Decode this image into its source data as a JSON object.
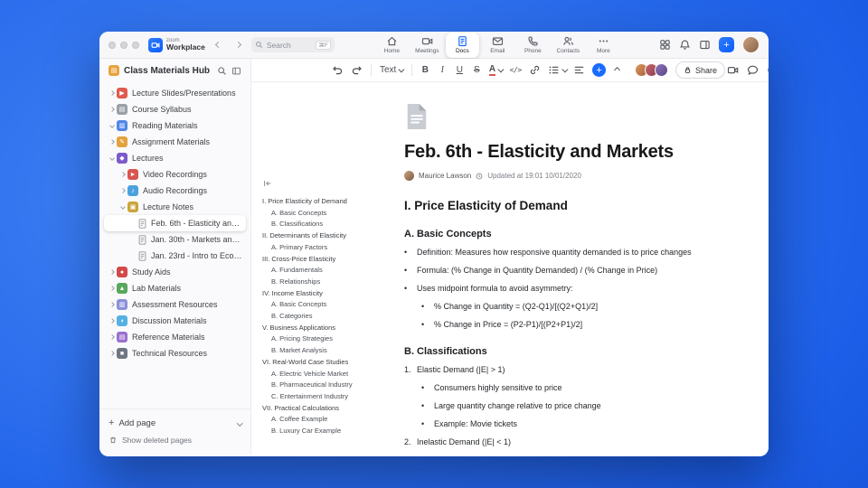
{
  "titlebar": {
    "brand_zoom": "zoom",
    "brand_workplace": "Workplace",
    "search": {
      "placeholder": "Search",
      "shortcut": "⌘F"
    },
    "tabs": [
      {
        "label": "Home"
      },
      {
        "label": "Meetings"
      },
      {
        "label": "Docs"
      },
      {
        "label": "Email"
      },
      {
        "label": "Phone"
      },
      {
        "label": "Contacts"
      },
      {
        "label": "More"
      }
    ]
  },
  "glyphs": {
    "plus": "+"
  },
  "sidebar": {
    "title": "Class Materials Hub",
    "items": [
      {
        "label": "Lecture Slides/Presentations",
        "depth": 0,
        "chev": "right",
        "type": "folder",
        "icon": "▶",
        "color": "#e05a4e"
      },
      {
        "label": "Course Syllabus",
        "depth": 0,
        "chev": "right",
        "type": "folder",
        "icon": "▤",
        "color": "#9aa0a8"
      },
      {
        "label": "Reading Materials",
        "depth": 0,
        "chev": "down",
        "type": "folder",
        "icon": "▥",
        "color": "#4f86e8"
      },
      {
        "label": "Assignment Materials",
        "depth": 0,
        "chev": "right",
        "type": "folder",
        "icon": "✎",
        "color": "#e3a23c"
      },
      {
        "label": "Lectures",
        "depth": 0,
        "chev": "down",
        "type": "folder",
        "icon": "◆",
        "color": "#7b5bc9"
      },
      {
        "label": "Video Recordings",
        "depth": 1,
        "chev": "right",
        "type": "folder",
        "icon": "►",
        "color": "#d95550"
      },
      {
        "label": "Audio Recordings",
        "depth": 1,
        "chev": "right",
        "type": "folder",
        "icon": "♪",
        "color": "#4aa3de"
      },
      {
        "label": "Lecture Notes",
        "depth": 1,
        "chev": "down",
        "type": "folder",
        "icon": "▣",
        "color": "#caa53e"
      },
      {
        "label": "Feb. 6th - Elasticity and M…",
        "depth": 2,
        "chev": "none",
        "type": "page",
        "state": "selected"
      },
      {
        "label": "Jan. 30th - Markets and P…",
        "depth": 2,
        "chev": "none",
        "type": "page"
      },
      {
        "label": "Jan. 23rd - Intro to Econo…",
        "depth": 2,
        "chev": "none",
        "type": "page"
      },
      {
        "label": "Study Aids",
        "depth": 0,
        "chev": "right",
        "type": "folder",
        "icon": "●",
        "color": "#d2494a"
      },
      {
        "label": "Lab Materials",
        "depth": 0,
        "chev": "right",
        "type": "folder",
        "icon": "▲",
        "color": "#58a85c"
      },
      {
        "label": "Assessment Resources",
        "depth": 0,
        "chev": "right",
        "type": "folder",
        "icon": "▥",
        "color": "#8a8fd8"
      },
      {
        "label": "Discussion Materials",
        "depth": 0,
        "chev": "right",
        "type": "folder",
        "icon": "◖",
        "color": "#56b1e3"
      },
      {
        "label": "Reference Materials",
        "depth": 0,
        "chev": "right",
        "type": "folder",
        "icon": "▤",
        "color": "#9a6fd0"
      },
      {
        "label": "Technical Resources",
        "depth": 0,
        "chev": "right",
        "type": "folder",
        "icon": "■",
        "color": "#6e7681"
      }
    ],
    "add_page": "Add page",
    "show_deleted": "Show deleted pages"
  },
  "toolbar": {
    "text_style": "Text",
    "bold": "B",
    "italic": "I",
    "underline": "U",
    "strike": "S",
    "color": "A",
    "code": "</>",
    "share": "Share"
  },
  "doc": {
    "title": "Feb. 6th - Elasticity and Markets",
    "author": "Maurice Lawson",
    "updated": "Updated at 19:01 10/01/2020",
    "outline": [
      {
        "text": "I. Price Elasticity of Demand",
        "depth": 0
      },
      {
        "text": "A. Basic Concepts",
        "depth": 1
      },
      {
        "text": "B. Classifications",
        "depth": 1
      },
      {
        "text": "II. Determinants of Elasticity",
        "depth": 0
      },
      {
        "text": "A. Primary Factors",
        "depth": 1
      },
      {
        "text": "III. Cross-Price Elasticity",
        "depth": 0
      },
      {
        "text": "A. Fundamentals",
        "depth": 1
      },
      {
        "text": "B. Relationships",
        "depth": 1
      },
      {
        "text": "IV. Income Elasticity",
        "depth": 0
      },
      {
        "text": "A. Basic Concepts",
        "depth": 1
      },
      {
        "text": "B. Categories",
        "depth": 1
      },
      {
        "text": "V. Business Applications",
        "depth": 0
      },
      {
        "text": "A. Pricing Strategies",
        "depth": 1
      },
      {
        "text": "B. Market Analysis",
        "depth": 1
      },
      {
        "text": "VI. Real-World Case Studies",
        "depth": 0
      },
      {
        "text": "A. Electric Vehicle Market",
        "depth": 1
      },
      {
        "text": "B. Pharmaceutical Industry",
        "depth": 1
      },
      {
        "text": "C. Entertainment Industry",
        "depth": 1
      },
      {
        "text": "VII. Practical Calculations",
        "depth": 0
      },
      {
        "text": "A. Coffee Example",
        "depth": 1
      },
      {
        "text": "B. Luxury Car Example",
        "depth": 1
      }
    ],
    "body": [
      {
        "type": "h2",
        "text": "I. Price Elasticity of Demand"
      },
      {
        "type": "h3",
        "text": "A. Basic Concepts"
      },
      {
        "type": "li",
        "marker": "•",
        "depth": 0,
        "text": "Definition: Measures how responsive quantity demanded is to price changes"
      },
      {
        "type": "li",
        "marker": "•",
        "depth": 0,
        "text": "Formula: (% Change in Quantity Demanded) / (% Change in Price)"
      },
      {
        "type": "li",
        "marker": "•",
        "depth": 0,
        "text": "Uses midpoint formula to avoid asymmetry:"
      },
      {
        "type": "li",
        "marker": "•",
        "depth": 1,
        "text": "% Change in Quantity = (Q2-Q1)/[(Q2+Q1)/2]"
      },
      {
        "type": "li",
        "marker": "•",
        "depth": 1,
        "text": "% Change in Price = (P2-P1)/[(P2+P1)/2]"
      },
      {
        "type": "h3",
        "text": "B. Classifications"
      },
      {
        "type": "li",
        "marker": "1.",
        "depth": 0,
        "text": "Elastic Demand (|E| > 1)"
      },
      {
        "type": "li",
        "marker": "•",
        "depth": 1,
        "text": "Consumers highly sensitive to price"
      },
      {
        "type": "li",
        "marker": "•",
        "depth": 1,
        "text": "Large quantity change relative to price change"
      },
      {
        "type": "li",
        "marker": "•",
        "depth": 1,
        "text": "Example: Movie tickets"
      },
      {
        "type": "li",
        "marker": "2.",
        "depth": 0,
        "text": "Inelastic Demand (|E| < 1)"
      }
    ]
  }
}
